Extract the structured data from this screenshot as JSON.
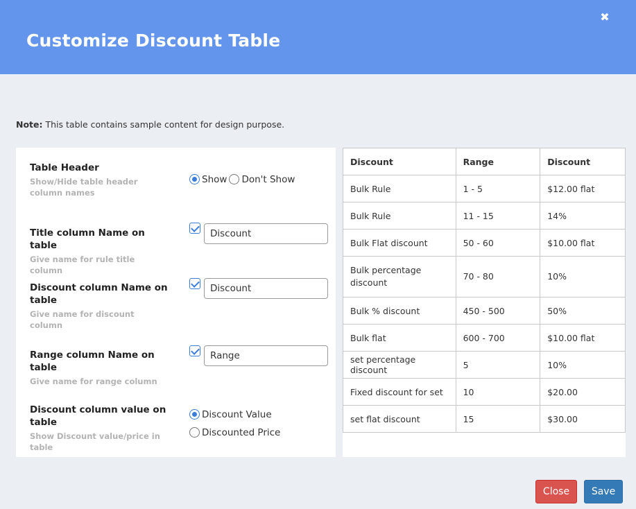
{
  "header": {
    "title": "Customize Discount Table",
    "close_glyph": "✖"
  },
  "note": {
    "bold": "Note:",
    "text": " This table contains sample content for design purpose."
  },
  "settings": {
    "table_header": {
      "label": "Table Header",
      "desc": "Show/Hide table header column names",
      "options": [
        "Show",
        "Don't Show"
      ],
      "selected": "Show"
    },
    "title_column": {
      "label": "Title column Name on table",
      "desc": "Give name for rule title column",
      "checked": true,
      "value": "Discount"
    },
    "discount_column": {
      "label": "Discount column Name on table",
      "desc": "Give name for discount column",
      "checked": true,
      "value": "Discount"
    },
    "range_column": {
      "label": "Range column Name on table",
      "desc": "Give name for range column",
      "checked": true,
      "value": "Range"
    },
    "discount_value": {
      "label": "Discount column value on table",
      "desc": "Show Discount value/price in table",
      "options": [
        "Discount Value",
        "Discounted Price"
      ],
      "selected": "Discount Value"
    }
  },
  "preview_table": {
    "headers": [
      "Discount",
      "Range",
      "Discount"
    ],
    "rows": [
      [
        "Bulk Rule",
        "1 - 5",
        "$12.00 flat"
      ],
      [
        "Bulk Rule",
        "11 - 15",
        "14%"
      ],
      [
        "Bulk Flat discount",
        "50 - 60",
        "$10.00 flat"
      ],
      [
        "Bulk percentage discount",
        "70 - 80",
        "10%"
      ],
      [
        "Bulk % discount",
        "450 - 500",
        "50%"
      ],
      [
        "Bulk flat",
        "600 - 700",
        "$10.00 flat"
      ],
      [
        "set percentage discount",
        "5",
        "10%"
      ],
      [
        "Fixed discount for set",
        "10",
        "$20.00"
      ],
      [
        "set flat discount",
        "15",
        "$30.00"
      ]
    ]
  },
  "footer": {
    "close_label": "Close",
    "save_label": "Save"
  },
  "colors": {
    "header_bg": "#6495ed",
    "close_btn": "#d9534f",
    "save_btn": "#337ab7",
    "accent": "#3b7dd8"
  }
}
